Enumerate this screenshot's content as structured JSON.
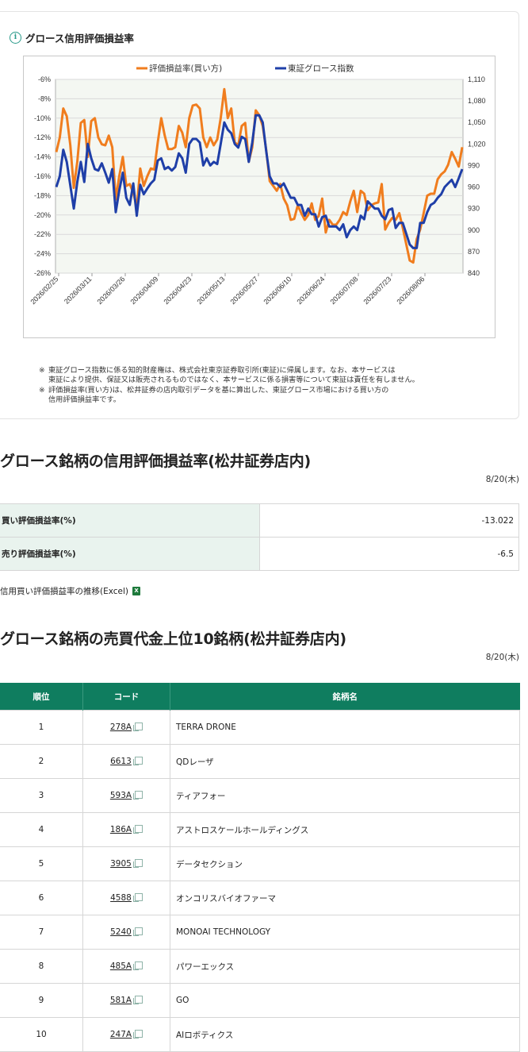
{
  "section1": {
    "title": "グロース信用評価損益率",
    "notes": [
      {
        "mark": "※",
        "lines": [
          "東証グロース指数に係る知的財産権は、株式会社東京証券取引所(東証)に帰属します。なお、本サービスは",
          "東証により提供、保証又は販売されるものではなく、本サービスに係る損害等について東証は責任を有しません。"
        ]
      },
      {
        "mark": "※",
        "lines": [
          "評価損益率(買い方)は、松井証券の店内取引データを基に算出した、東証グロース市場における買い方の",
          "信用評価損益率です。"
        ]
      }
    ]
  },
  "chart_data": {
    "type": "line",
    "legend": [
      "評価損益率(買い方)",
      "東証グロース指数"
    ],
    "legend_position": "top",
    "colors": {
      "rate": "#f07d1e",
      "index": "#1f3fa8",
      "plot_bg": "#f4f7f2",
      "grid": "#d9d9d9"
    },
    "x_tick_labels": [
      "2026/02/25",
      "2026/03/11",
      "2026/03/26",
      "2026/04/09",
      "2026/04/23",
      "2026/05/13",
      "2026/05/27",
      "2026/06/10",
      "2026/06/24",
      "2026/07/08",
      "2026/07/23",
      "2026/08/06"
    ],
    "y_left": {
      "ticks": [
        "-6%",
        "-8%",
        "-10%",
        "-12%",
        "-14%",
        "-16%",
        "-18%",
        "-20%",
        "-22%",
        "-24%",
        "-26%"
      ],
      "min": -26,
      "max": -6
    },
    "y_right": {
      "ticks": [
        "1,110",
        "1,080",
        "1,050",
        "1,020",
        "990",
        "960",
        "930",
        "900",
        "870",
        "840"
      ],
      "min": 840,
      "max": 1110
    },
    "grid": true,
    "series": [
      {
        "name": "評価損益率(買い方)",
        "axis": "left",
        "values": [
          -13.5,
          -12.0,
          -9.0,
          -9.8,
          -12.8,
          -17.2,
          -14.5,
          -10.5,
          -10.2,
          -14.0,
          -10.3,
          -10.0,
          -12.0,
          -12.7,
          -12.8,
          -11.8,
          -13.0,
          -18.4,
          -16.0,
          -14.0,
          -17.0,
          -16.8,
          -17.7,
          -19.2,
          -15.2,
          -17.0,
          -16.0,
          -15.2,
          -15.3,
          -12.5,
          -10.0,
          -11.8,
          -13.2,
          -13.2,
          -13.0,
          -10.8,
          -11.5,
          -13.0,
          -10.0,
          -8.7,
          -8.6,
          -9.0,
          -12.0,
          -13.0,
          -12.0,
          -12.8,
          -12.2,
          -10.0,
          -7.0,
          -10.0,
          -9.0,
          -12.5,
          -12.8,
          -10.8,
          -10.5,
          -14.5,
          -13.0,
          -9.2,
          -9.7,
          -10.8,
          -13.3,
          -16.5,
          -17.0,
          -17.5,
          -16.8,
          -18.3,
          -19.0,
          -20.5,
          -20.4,
          -19.0,
          -19.8,
          -20.5,
          -20.0,
          -18.8,
          -20.5,
          -20.1,
          -18.3,
          -21.8,
          -20.5,
          -21.0,
          -21.0,
          -20.5,
          -19.7,
          -20.0,
          -18.6,
          -17.5,
          -19.7,
          -17.5,
          -17.8,
          -19.5,
          -19.0,
          -18.8,
          -18.7,
          -16.8,
          -21.5,
          -20.8,
          -20.3,
          -20.5,
          -19.8,
          -21.3,
          -23.0,
          -24.7,
          -24.9,
          -22.5,
          -21.5,
          -19.8,
          -18.0,
          -17.8,
          -17.8,
          -16.3,
          -15.8,
          -15.5,
          -14.8,
          -13.5,
          -14.2,
          -15.0,
          -13.0
        ]
      },
      {
        "name": "東証グロース指数",
        "axis": "right",
        "values": [
          960,
          975,
          1012,
          995,
          962,
          930,
          967,
          995,
          967,
          1020,
          1000,
          985,
          983,
          993,
          980,
          966,
          985,
          925,
          955,
          980,
          945,
          935,
          965,
          920,
          963,
          950,
          958,
          965,
          970,
          997,
          1000,
          985,
          988,
          983,
          988,
          1007,
          1000,
          980,
          1020,
          1027,
          1027,
          1022,
          990,
          1000,
          990,
          995,
          992,
          1020,
          1050,
          1040,
          1035,
          1020,
          1015,
          1030,
          1027,
          995,
          1022,
          1060,
          1060,
          1050,
          1010,
          975,
          965,
          965,
          960,
          965,
          955,
          945,
          945,
          935,
          935,
          920,
          930,
          922,
          922,
          905,
          918,
          920,
          905,
          905,
          905,
          900,
          908,
          890,
          900,
          905,
          900,
          920,
          915,
          940,
          935,
          930,
          930,
          920,
          915,
          928,
          930,
          903,
          910,
          910,
          895,
          880,
          875,
          875,
          910,
          910,
          925,
          935,
          938,
          945,
          950,
          960,
          965,
          970,
          960,
          972,
          985
        ]
      }
    ]
  },
  "section2": {
    "title": "グロース銘柄の信用評価損益率(松井証券店内)",
    "date": "8/20(木)",
    "rows": [
      {
        "label": "買い評価損益率(%)",
        "value": "-13.022"
      },
      {
        "label": "売り評価損益率(%)",
        "value": "-6.5"
      }
    ],
    "excel_link": "信用買い評価損益率の推移(Excel)",
    "excel_icon": "excel-icon"
  },
  "section3": {
    "title": "グロース銘柄の売買代金上位10銘柄(松井証券店内)",
    "date": "8/20(木)",
    "headers": {
      "rank": "順位",
      "code": "コード",
      "name": "銘柄名"
    },
    "rows": [
      {
        "rank": "1",
        "code": "278A",
        "name": "TERRA DRONE"
      },
      {
        "rank": "2",
        "code": "6613",
        "name": "QDレーザ"
      },
      {
        "rank": "3",
        "code": "593A",
        "name": "ティアフォー"
      },
      {
        "rank": "4",
        "code": "186A",
        "name": "アストロスケールホールディングス"
      },
      {
        "rank": "5",
        "code": "3905",
        "name": "データセクション"
      },
      {
        "rank": "6",
        "code": "4588",
        "name": "オンコリスバイオファーマ"
      },
      {
        "rank": "7",
        "code": "5240",
        "name": "MONOAI TECHNOLOGY"
      },
      {
        "rank": "8",
        "code": "485A",
        "name": "パワーエックス"
      },
      {
        "rank": "9",
        "code": "581A",
        "name": "GO"
      },
      {
        "rank": "10",
        "code": "247A",
        "name": "AIロボティクス"
      }
    ]
  }
}
